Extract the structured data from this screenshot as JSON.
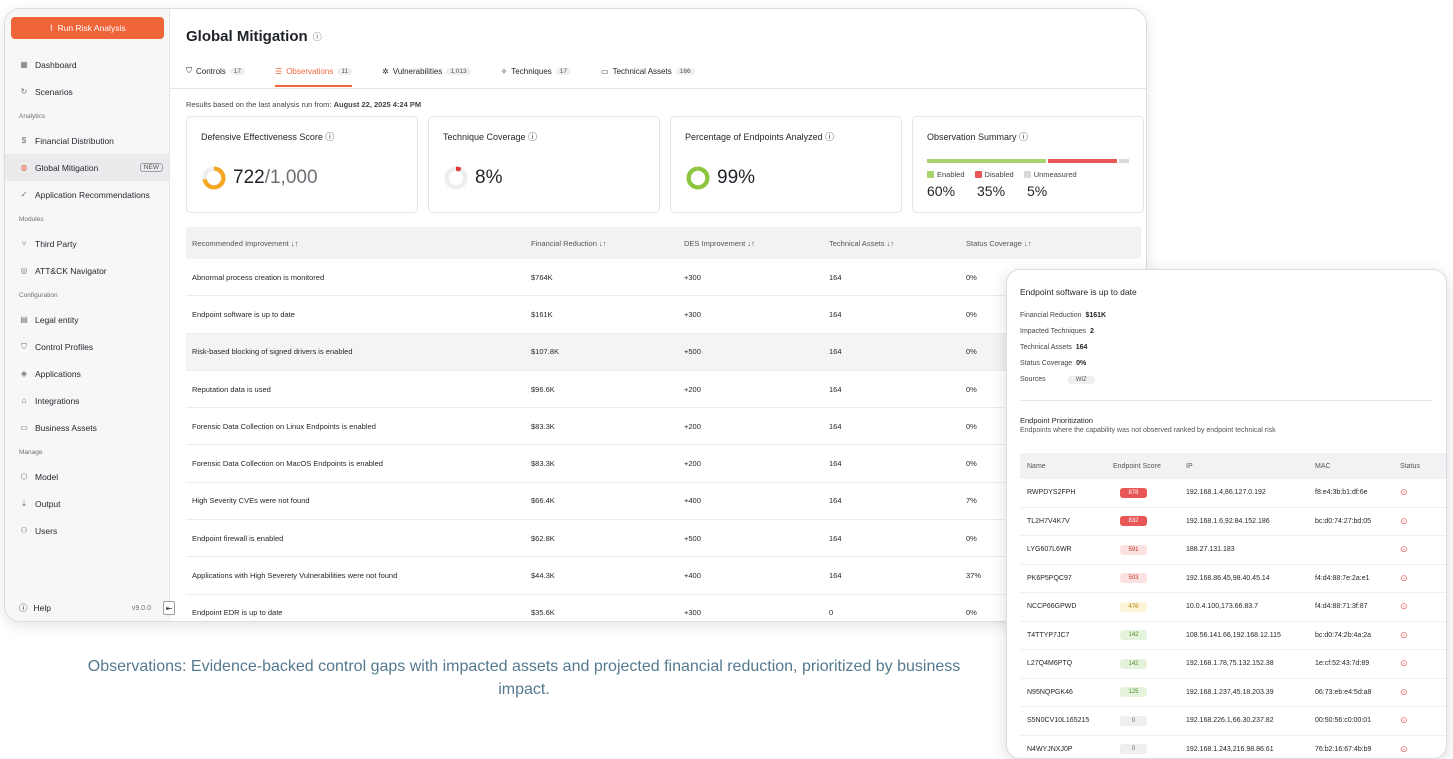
{
  "sidebar": {
    "run_label": "Run Risk Analysis",
    "groups": {
      "analytics": "Analytics",
      "modules": "Modules",
      "configuration": "Configuration",
      "manage": "Manage"
    },
    "items": {
      "dashboard": "Dashboard",
      "scenarios": "Scenarios",
      "financial": "Financial Distribution",
      "global": "Global Mitigation",
      "apprec": "Application Recommendations",
      "thirdparty": "Third Party",
      "attack": "ATT&CK Navigator",
      "legal": "Legal entity",
      "control": "Control Profiles",
      "applications": "Applications",
      "integrations": "Integrations",
      "business": "Business Assets",
      "model": "Model",
      "output": "Output",
      "users": "Users"
    },
    "new_badge": "NEW",
    "help": "Help",
    "version": "v9.0.0"
  },
  "page": {
    "title": "Global Mitigation",
    "results_prefix": "Results based on the last analysis run from: ",
    "results_date": "August 22, 2025 4:24 PM"
  },
  "tabs": [
    {
      "label": "Controls",
      "count": "17"
    },
    {
      "label": "Observations",
      "count": "11"
    },
    {
      "label": "Vulnerabilities",
      "count": "1,013"
    },
    {
      "label": "Techniques",
      "count": "17"
    },
    {
      "label": "Technical Assets",
      "count": "166"
    }
  ],
  "cards": {
    "des": {
      "title": "Defensive Effectiveness Score",
      "value": "722",
      "suffix": "/1,000"
    },
    "tech": {
      "title": "Technique Coverage",
      "value": "8%"
    },
    "endpoints": {
      "title": "Percentage of Endpoints Analyzed",
      "value": "99%"
    },
    "summary": {
      "title": "Observation Summary",
      "enabled_label": "Enabled",
      "disabled_label": "Disabled",
      "unmeasured_label": "Unmeasured",
      "enabled": "60%",
      "disabled": "35%",
      "unmeasured": "5%",
      "enabled_frac": 0.6,
      "disabled_frac": 0.35,
      "unmeasured_frac": 0.05
    }
  },
  "levels": {
    "des": 0.722,
    "tech": 0.08,
    "endpoints": 0.99
  },
  "colors": {
    "accent": "#f0643a",
    "enabled": "#a8d46f",
    "disabled": "#e85656",
    "unmeasured": "#d9d9dc",
    "ring_orange": "#f5a623",
    "ring_green": "#8cc63f"
  },
  "table": {
    "headers": [
      "Recommended Improvement",
      "Financial Reduction",
      "DES Improvement",
      "Technical Assets",
      "Status Coverage"
    ],
    "rows": [
      [
        "Abnormal process creation is monitored",
        "$764K",
        "+300",
        "164",
        "0%"
      ],
      [
        "Endpoint software is up to date",
        "$161K",
        "+300",
        "164",
        "0%"
      ],
      [
        "Risk-based blocking of signed drivers is enabled",
        "$107.8K",
        "+500",
        "164",
        "0%"
      ],
      [
        "Reputation data is used",
        "$96.6K",
        "+200",
        "164",
        "0%"
      ],
      [
        "Forensic Data Collection on Linux Endpoints is enabled",
        "$83.3K",
        "+200",
        "164",
        "0%"
      ],
      [
        "Forensic Data Collection on MacOS Endpoints is enabled",
        "$83.3K",
        "+200",
        "164",
        "0%"
      ],
      [
        "High Severity CVEs were not found",
        "$66.4K",
        "+400",
        "164",
        "7%"
      ],
      [
        "Endpoint firewall is enabled",
        "$62.8K",
        "+500",
        "164",
        "0%"
      ],
      [
        "Applications with High Severety Vulnerabilities were not found",
        "$44.3K",
        "+400",
        "164",
        "37%"
      ],
      [
        "Endpoint EDR is up to date",
        "$35.6K",
        "+300",
        "0",
        "0%"
      ]
    ]
  },
  "caption": "Observations: Evidence-backed control gaps with impacted assets and projected financial reduction, prioritized by business impact.",
  "panel": {
    "title": "Endpoint software is up to date",
    "fields": [
      {
        "k": "Financial Reduction",
        "v": "$161K"
      },
      {
        "k": "Impacted Techniques",
        "v": "2"
      },
      {
        "k": "Technical Assets",
        "v": "164"
      },
      {
        "k": "Status Coverage",
        "v": "0%"
      }
    ],
    "sources_label": "Sources",
    "source": "WIZ",
    "prio_title": "Endpoint Prioritization",
    "prio_desc": "Endpoints where the capability was not observed ranked by endpoint technical risk",
    "headers": [
      "Name",
      "Endpoint Score",
      "IP",
      "MAC",
      "Status"
    ],
    "rows": [
      {
        "name": "RWPDYS2FPH",
        "score": "878",
        "level": "red",
        "ip": "192.168.1.4,86.127.0.192",
        "mac": "f8:e4:3b:b1:df:6e"
      },
      {
        "name": "TL2H7V4K7V",
        "score": "832",
        "level": "red",
        "ip": "192.168.1.6,92.84.152.186",
        "mac": "bc:d0:74:27:bd:05"
      },
      {
        "name": "LYG607L6WR",
        "score": "591",
        "level": "lred",
        "ip": "188.27.131.183",
        "mac": ""
      },
      {
        "name": "PK6P5PQC97",
        "score": "503",
        "level": "lred",
        "ip": "192.168.86.45,98.40.45.14",
        "mac": "f4:d4:88:7e:2a:e1"
      },
      {
        "name": "NCCP66GPWD",
        "score": "476",
        "level": "yel",
        "ip": "10.0.4.100,173.66.83.7",
        "mac": "f4:d4:88:71:3f:87"
      },
      {
        "name": "T4TTYP7JC7",
        "score": "142",
        "level": "grn",
        "ip": "108.56.141.66,192.168.12.115",
        "mac": "bc:d0:74:2b:4a:2a"
      },
      {
        "name": "L27Q4M6PTQ",
        "score": "142",
        "level": "grn",
        "ip": "192.168.1.78,75.132.152.38",
        "mac": "1e:cf:52:43:7d:89"
      },
      {
        "name": "N95NQPGK46",
        "score": "125",
        "level": "grn",
        "ip": "192.168.1.237,45.18.203.39",
        "mac": "06:73:eb:e4:5d:a8"
      },
      {
        "name": "S5N0CV10L165215",
        "score": "0",
        "level": "gry",
        "ip": "192.168.226.1,66.30.237.82",
        "mac": "00:50:56:c0:00:01"
      },
      {
        "name": "N4WYJNXJ0P",
        "score": "0",
        "level": "gry",
        "ip": "192.168.1.243,216.98.86.61",
        "mac": "76:b2:16:67:4b:b9"
      }
    ]
  }
}
